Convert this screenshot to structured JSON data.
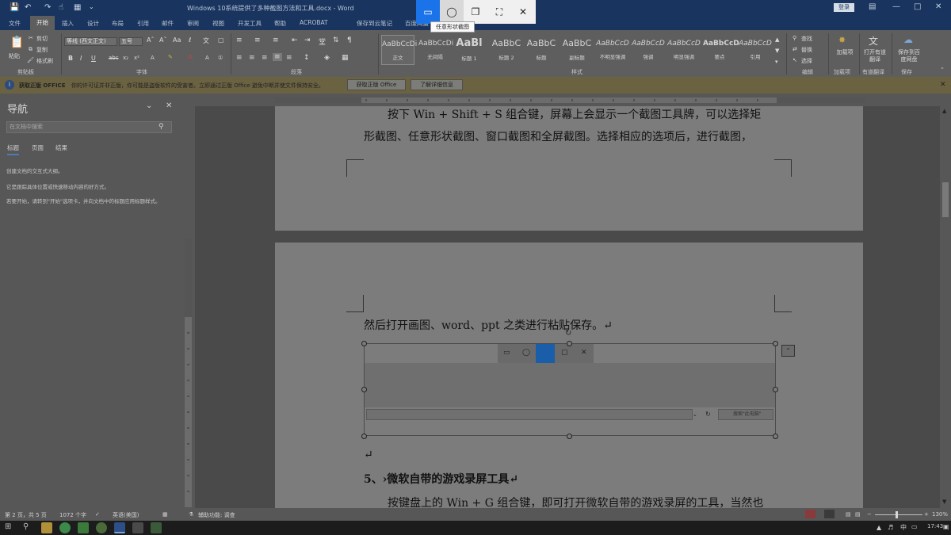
{
  "window": {
    "title": "Windows 10系统提供了多种截图方法和工具.docx  -  Word",
    "signin": "登录",
    "min_icon": "minimize-icon",
    "restore_icon": "restore-icon",
    "close_icon": "close-icon"
  },
  "quick_access": [
    "save-icon",
    "undo-icon",
    "redo-icon",
    "touch-mode-icon",
    "customize-icon"
  ],
  "tabs": [
    "文件",
    "开始",
    "插入",
    "设计",
    "布局",
    "引用",
    "邮件",
    "审阅",
    "视图",
    "开发工具",
    "帮助",
    "ACROBAT",
    "保存到云笔记",
    "百度网盘"
  ],
  "ribbon": {
    "clipboard": {
      "paste": "粘贴",
      "cut": "剪切",
      "copy": "复制",
      "painter": "格式刷",
      "group": "剪贴板"
    },
    "font": {
      "name": "等线 (西文正文)",
      "size": "五号",
      "group": "字体"
    },
    "paragraph": {
      "group": "段落"
    },
    "styles": {
      "group": "样式",
      "items": [
        {
          "sample": "AaBbCcDi",
          "name": "正文"
        },
        {
          "sample": "AaBbCcDi",
          "name": "无间隔"
        },
        {
          "sample": "AaBl",
          "name": "标题 1"
        },
        {
          "sample": "AaBbC",
          "name": "标题 2"
        },
        {
          "sample": "AaBbC",
          "name": "标题"
        },
        {
          "sample": "AaBbC",
          "name": "副标题"
        },
        {
          "sample": "AaBbCcD",
          "name": "不明显强调"
        },
        {
          "sample": "AaBbCcD",
          "name": "强调"
        },
        {
          "sample": "AaBbCcD",
          "name": "明显强调"
        },
        {
          "sample": "AaBbCcD",
          "name": "要点"
        },
        {
          "sample": "AaBbCcD",
          "name": "引用"
        }
      ]
    },
    "editing": {
      "find": "查找",
      "replace": "替换",
      "select": "选择",
      "group": "编辑"
    },
    "addins": {
      "label": "加载项",
      "group": "加载项"
    },
    "translate": {
      "label": "打开有道翻译",
      "group": "有道翻译"
    },
    "save": {
      "label": "保存到百度网盘",
      "group": "保存"
    }
  },
  "infobar": {
    "title": "获取正版 OFFICE",
    "message": "你的许可证并非正版，你可能是盗版软件的受害者。立即通过正版 Office 避免中断并使文件保持安全。",
    "btn_primary": "获取正版 Office",
    "btn_secondary": "了解详细信息"
  },
  "nav": {
    "title": "导航",
    "search_placeholder": "在文档中搜索",
    "tabs": [
      "标题",
      "页面",
      "结果"
    ],
    "lines": [
      "创建文档的交互式大纲。",
      "它是跟踪具体位置或快速移动内容的好方式。",
      "若要开始，请转到\"开始\"选项卡，并向文档中的标题应用标题样式。"
    ]
  },
  "document": {
    "p1": "按下 Win + Shift + S 组合键，屏幕上会显示一个截图工具牌，可以选择矩",
    "p2": "形截图、任意形状截图、窗口截图和全屏截图。选择相应的选项后，进行截图，",
    "p3": "然后打开画图、word、ppt 之类进行粘贴保存。↵",
    "embedded_search": "搜索\"此电脑\"",
    "empty_mark": "↵",
    "heading": "5、›微软自带的游戏录屏工具↵",
    "p4": "按键盘上的 Win + G 组合键，即可打开微软自带的游戏录屏的工具，当然也"
  },
  "snip_toolbar": {
    "tooltip": "任意形状截图",
    "buttons": [
      "rectangle-snip-icon",
      "freeform-snip-icon",
      "window-snip-icon",
      "fullscreen-snip-icon",
      "close-icon"
    ]
  },
  "statusbar": {
    "page": "第 2 页，共 5 页",
    "words": "1072 个字",
    "lang": "英语(美国)",
    "accessibility": "辅助功能: 调查",
    "zoom": "130%"
  },
  "taskbar": {
    "time": "17:43",
    "ime": "中"
  }
}
